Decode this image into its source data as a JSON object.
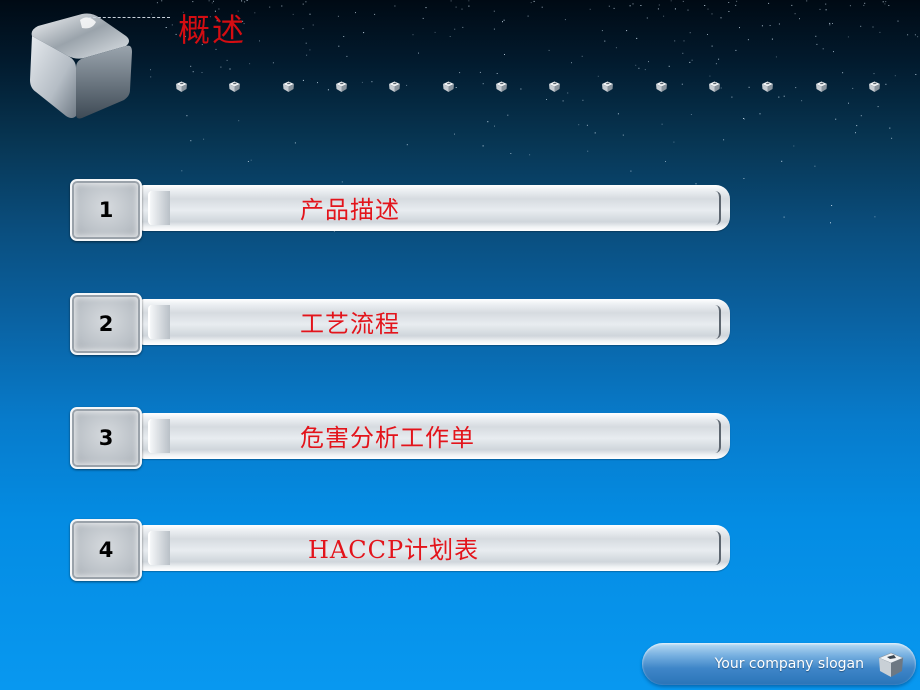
{
  "header": {
    "title": "概述",
    "mini_cube_count": 14
  },
  "menu": {
    "items": [
      {
        "number": "1",
        "label": "产品描述"
      },
      {
        "number": "2",
        "label": "工艺流程"
      },
      {
        "number": "3",
        "label": "危害分析工作单"
      },
      {
        "number": "4",
        "label": "HACCP计划表"
      }
    ]
  },
  "footer": {
    "slogan": "Your company slogan"
  },
  "colors": {
    "title": "#d40d12",
    "item_label": "#e3141b",
    "number": "#000000",
    "slogan_text": "#ffffff"
  }
}
